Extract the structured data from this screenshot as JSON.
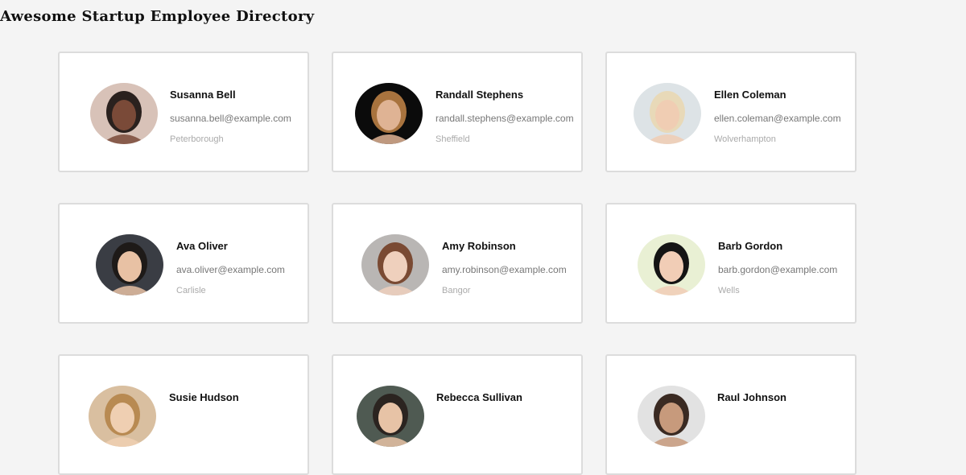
{
  "page": {
    "title": "Awesome Startup Employee Directory"
  },
  "employees": [
    {
      "name": "Susanna Bell",
      "email": "susanna.bell@example.com",
      "city": "Peterborough",
      "bg": "#d8c2b8",
      "skin": "#7a4a38",
      "hair": "#2a211e"
    },
    {
      "name": "Randall Stephens",
      "email": "randall.stephens@example.com",
      "city": "Sheffield",
      "bg": "#0b0b0b",
      "skin": "#dfb394",
      "hair": "#a8733e"
    },
    {
      "name": "Ellen Coleman",
      "email": "ellen.coleman@example.com",
      "city": "Wolverhampton",
      "bg": "#dde3e6",
      "skin": "#f0cdb3",
      "hair": "#e8d9b8"
    },
    {
      "name": "Ava Oliver",
      "email": "ava.oliver@example.com",
      "city": "Carlisle",
      "bg": "#3a3d44",
      "skin": "#e8c1a4",
      "hair": "#1e1a18"
    },
    {
      "name": "Amy Robinson",
      "email": "amy.robinson@example.com",
      "city": "Bangor",
      "bg": "#b9b6b4",
      "skin": "#efd0bd",
      "hair": "#7a4a33"
    },
    {
      "name": "Barb Gordon",
      "email": "barb.gordon@example.com",
      "city": "Wells",
      "bg": "#e9f0d4",
      "skin": "#f1cdb6",
      "hair": "#141414"
    },
    {
      "name": "Susie Hudson",
      "email": "",
      "city": "",
      "bg": "#d9bfa0",
      "skin": "#efcfb2",
      "hair": "#b88a52"
    },
    {
      "name": "Rebecca Sullivan",
      "email": "",
      "city": "",
      "bg": "#4f5a52",
      "skin": "#e7c3a6",
      "hair": "#2b2420"
    },
    {
      "name": "Raul Johnson",
      "email": "",
      "city": "",
      "bg": "#e2e2e2",
      "skin": "#c79a7c",
      "hair": "#3a2a22"
    }
  ]
}
